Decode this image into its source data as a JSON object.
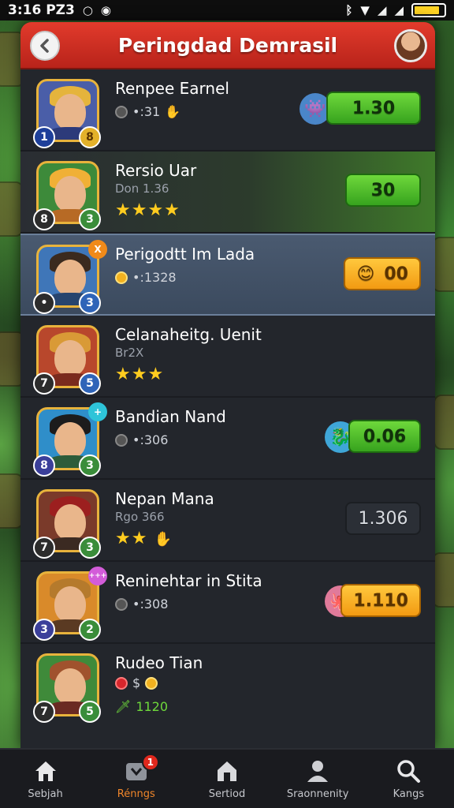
{
  "status_bar": {
    "time": "3:16 PZ3",
    "icons": [
      "circle-icon",
      "notification-icon",
      "bluetooth-icon",
      "wifi-icon",
      "signal-icon",
      "signal-icon",
      "battery-icon"
    ],
    "battery_color": "#ffd323"
  },
  "header": {
    "title": "Peringdad Demrasil",
    "back_icon": "chevron-left-icon",
    "profile_icon": "avatar-icon",
    "color": "#d52d21"
  },
  "rows": [
    {
      "name": "Renpee Earnel",
      "sub": "•:31",
      "sub_icon": "coin-icon",
      "sub_trail": "hand-icon",
      "stars": "",
      "price": "1.30",
      "price_style": "green",
      "left_badge": "1",
      "right_badge": "8",
      "corner_badge": ""
    },
    {
      "name": "Rersio Uar",
      "sub2": "Don 1.36",
      "stars": "★★★★",
      "price": "30",
      "price_style": "green",
      "left_badge": "8",
      "right_badge": "3",
      "corner_badge": ""
    },
    {
      "name": "Perigodtt Im Lada",
      "sub": "•:1328",
      "sub_icon": "coin-icon",
      "stars": "",
      "price": "00",
      "price_style": "orange",
      "left_badge": "•",
      "right_badge": "3",
      "corner_badge": "X"
    },
    {
      "name": "Celanaheitg. Uenit",
      "sub2": "Br2X",
      "stars": "★★★",
      "price": "",
      "price_style": "none",
      "left_badge": "7",
      "right_badge": "5",
      "corner_badge": ""
    },
    {
      "name": "Bandian Nand",
      "sub": "•:306",
      "sub_icon": "coin-icon",
      "stars": "",
      "price": "0.06",
      "price_style": "green",
      "left_badge": "8",
      "right_badge": "3",
      "corner_badge": "+"
    },
    {
      "name": "Nepan Mana",
      "sub2": "Rgo 366",
      "stars": "★★",
      "price": "1.306",
      "price_style": "dark",
      "left_badge": "7",
      "right_badge": "3",
      "corner_badge": ""
    },
    {
      "name": "Reninehtar in Stita",
      "sub": "•:308",
      "sub_icon": "coin-icon",
      "stars": "",
      "price": "1.110",
      "price_style": "orange",
      "left_badge": "3",
      "right_badge": "2",
      "corner_badge": "+++"
    },
    {
      "name": "Rudeo Tian",
      "sub": "$",
      "sub_icon": "gem-icon",
      "sub3": "1120",
      "stars": "",
      "price": "",
      "price_style": "none",
      "left_badge": "7",
      "right_badge": "5",
      "corner_badge": ""
    }
  ],
  "nav": [
    {
      "label": "Sebjah",
      "icon": "home-icon",
      "active": false
    },
    {
      "label": "Rénngs",
      "icon": "inbox-icon",
      "active": true,
      "badge": "1"
    },
    {
      "label": "Sertiod",
      "icon": "house-icon",
      "active": false
    },
    {
      "label": "Sraonnenity",
      "icon": "person-icon",
      "active": false
    },
    {
      "label": "Kangs",
      "icon": "search-icon",
      "active": false
    }
  ],
  "colors": {
    "green_price": "#37a31e",
    "orange_price": "#f29a12",
    "active_nav": "#f0862a",
    "star": "#ffcc1f"
  }
}
